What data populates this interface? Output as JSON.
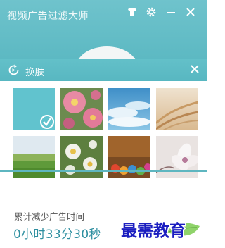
{
  "window": {
    "title": "视频广告过滤大师",
    "controls": [
      {
        "name": "skin-shirt-icon"
      },
      {
        "name": "settings-gear-icon"
      },
      {
        "name": "minimize-icon"
      },
      {
        "name": "close-icon"
      }
    ]
  },
  "skin_panel": {
    "title": "换肤",
    "tiles": [
      {
        "name": "skin-tile-solid-teal",
        "selected": true
      },
      {
        "name": "skin-tile-pink-flowers",
        "selected": false
      },
      {
        "name": "skin-tile-blue-sky",
        "selected": false
      },
      {
        "name": "skin-tile-wheat-field",
        "selected": false
      },
      {
        "name": "skin-tile-green-meadow",
        "selected": false
      },
      {
        "name": "skin-tile-daisies",
        "selected": false
      },
      {
        "name": "skin-tile-colored-pencils",
        "selected": false
      },
      {
        "name": "skin-tile-white-flower",
        "selected": false
      }
    ]
  },
  "stats": {
    "label": "累计减少广告时间",
    "value": "0小时33分30秒"
  },
  "watermark": {
    "text": "最需教育"
  },
  "colors": {
    "accent": "#5bb8c2",
    "value_text": "#2e8fa0"
  }
}
